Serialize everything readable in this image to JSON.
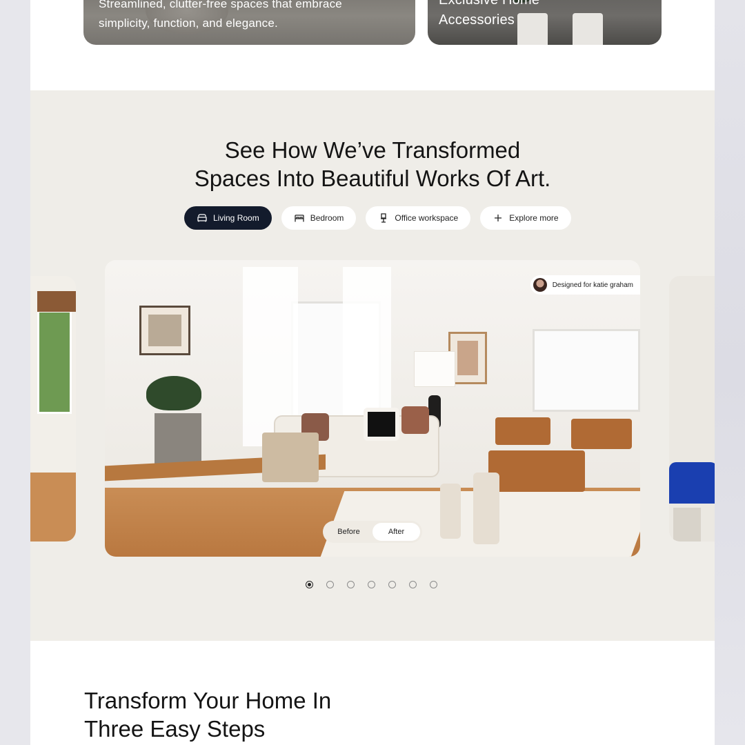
{
  "top_cards": {
    "left_text": "Streamlined, clutter-free spaces that embrace simplicity, function, and elegance.",
    "right_title": "Exclusive Home Accessories"
  },
  "gallery": {
    "heading_line1": "See How We’ve Transformed",
    "heading_line2": "Spaces Into Beautiful Works Of Art.",
    "tabs": [
      {
        "label": "Living Room",
        "icon": "sofa-icon",
        "active": true
      },
      {
        "label": "Bedroom",
        "icon": "bed-icon",
        "active": false
      },
      {
        "label": "Office workspace",
        "icon": "office-chair-icon",
        "active": false
      },
      {
        "label": "Explore more",
        "icon": "plus-icon",
        "active": false
      }
    ],
    "designed_for": "Designed for katie graham",
    "toggle": {
      "before": "Before",
      "after": "After",
      "selected": "After"
    },
    "carousel": {
      "total": 7,
      "active_index": 0
    }
  },
  "steps": {
    "heading_line1": "Transform Your Home In",
    "heading_line2": "Three Easy Steps"
  },
  "colors": {
    "accent_dark": "#131b2c",
    "section_bg": "#efede8"
  }
}
